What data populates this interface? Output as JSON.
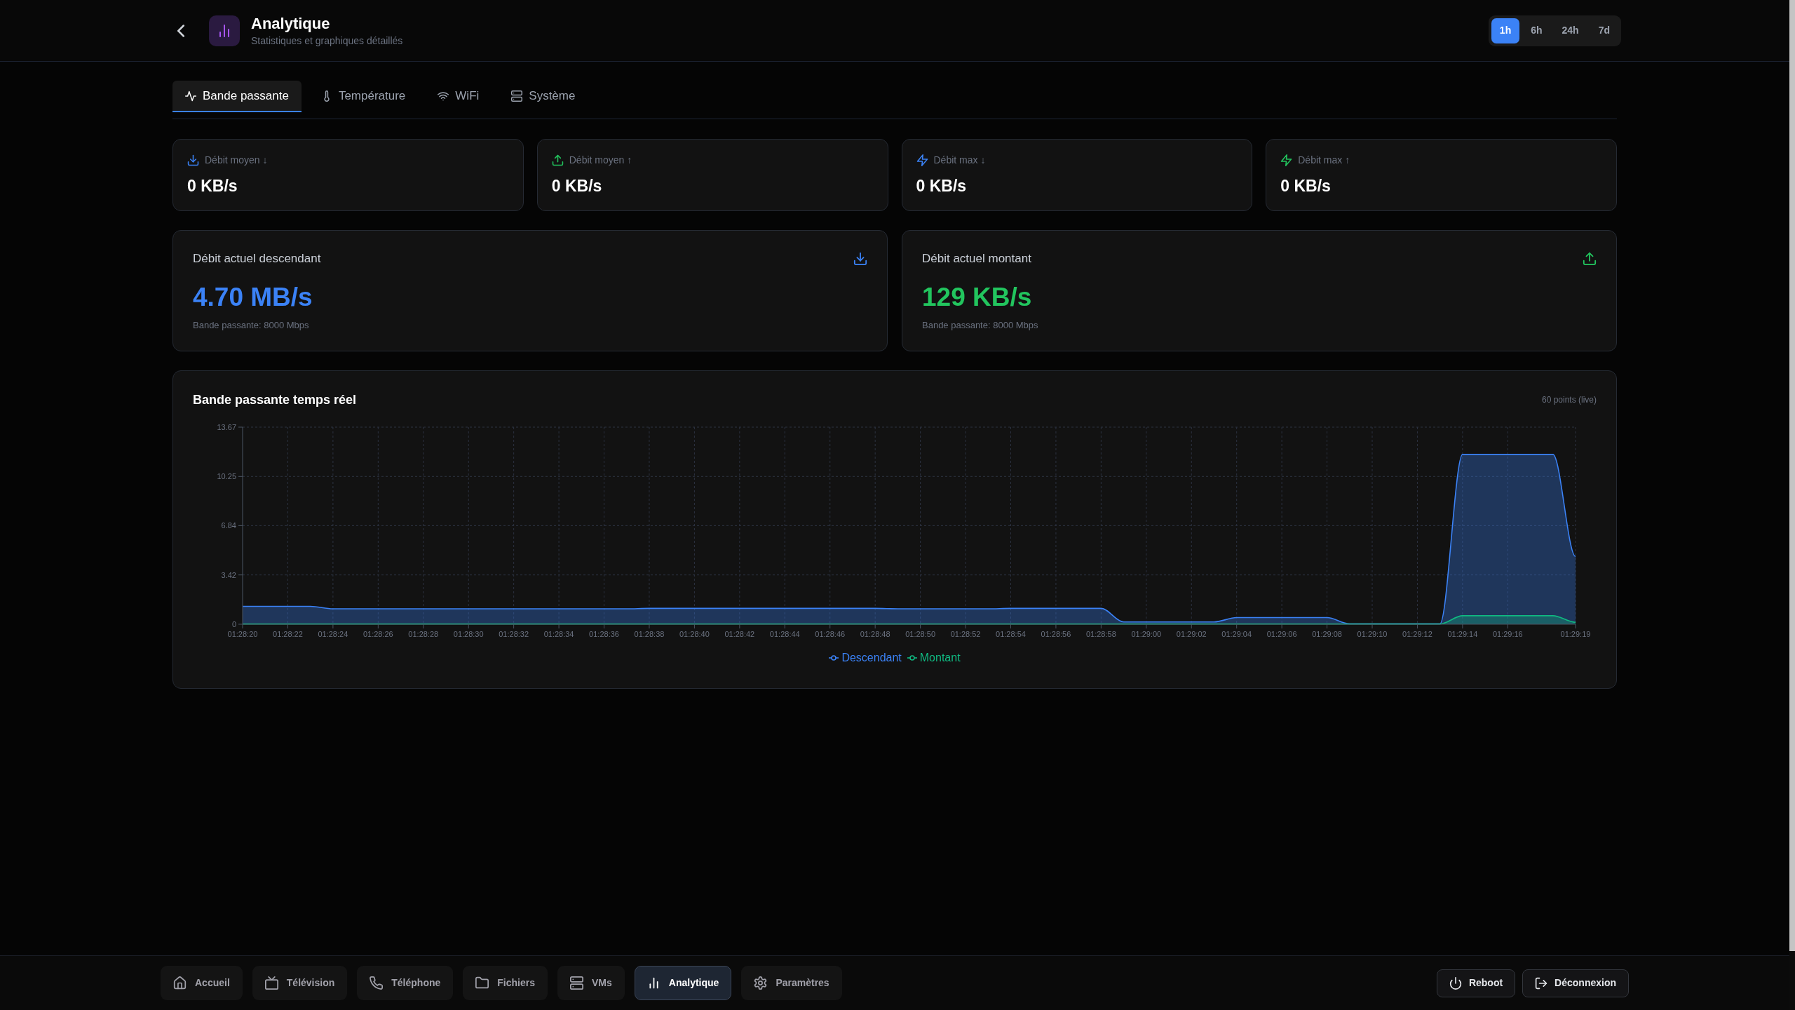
{
  "header": {
    "title": "Analytique",
    "subtitle": "Statistiques et graphiques détaillés"
  },
  "time_range": [
    {
      "label": "1h",
      "selected": true
    },
    {
      "label": "6h",
      "selected": false
    },
    {
      "label": "24h",
      "selected": false
    },
    {
      "label": "7d",
      "selected": false
    }
  ],
  "tabs": [
    {
      "label": "Bande passante",
      "selected": true
    },
    {
      "label": "Température",
      "selected": false
    },
    {
      "label": "WiFi",
      "selected": false
    },
    {
      "label": "Système",
      "selected": false
    }
  ],
  "summary_cards": [
    {
      "label": "Débit moyen ↓",
      "value": "0 KB/s",
      "color": "#3b82f6"
    },
    {
      "label": "Débit moyen ↑",
      "value": "0 KB/s",
      "color": "#22c55e"
    },
    {
      "label": "Débit max ↓",
      "value": "0 KB/s",
      "color": "#3b82f6"
    },
    {
      "label": "Débit max ↑",
      "value": "0 KB/s",
      "color": "#22c55e"
    }
  ],
  "current_cards": [
    {
      "title": "Débit actuel descendant",
      "value": "4.70 MB/s",
      "note": "Bande passante: 8000 Mbps",
      "color": "#3b82f6"
    },
    {
      "title": "Débit actuel montant",
      "value": "129 KB/s",
      "note": "Bande passante: 8000 Mbps",
      "color": "#22c55e"
    }
  ],
  "chart": {
    "title": "Bande passante temps réel",
    "note": "60 points (live)",
    "chart_data": [
      {
        "type": "area",
        "categories": [
          "01:28:20",
          null,
          "01:28:22",
          null,
          "01:28:24",
          null,
          "01:28:26",
          null,
          "01:28:28",
          null,
          "01:28:30",
          null,
          "01:28:32",
          null,
          "01:28:34",
          null,
          "01:28:36",
          null,
          "01:28:38",
          null,
          "01:28:40",
          null,
          "01:28:42",
          null,
          "01:28:44",
          null,
          "01:28:46",
          null,
          "01:28:48",
          null,
          "01:28:50",
          null,
          "01:28:52",
          null,
          "01:28:54",
          null,
          "01:28:56",
          null,
          "01:28:58",
          null,
          "01:29:00",
          null,
          "01:29:02",
          null,
          "01:29:04",
          null,
          "01:29:06",
          null,
          "01:29:08",
          null,
          "01:29:10",
          null,
          "01:29:12",
          null,
          "01:29:14",
          null,
          "01:29:16",
          null,
          null,
          "01:29:19"
        ],
        "ylim": [
          0,
          13.67
        ],
        "yticks": [
          0,
          3.42,
          6.84,
          10.25,
          13.67
        ],
        "grid": true,
        "legend": "bottom",
        "series": [
          {
            "name": "Descendant",
            "color": "#3b82f6",
            "values": [
              1.24,
              1.24,
              1.24,
              1.24,
              1.07,
              1.07,
              1.07,
              1.07,
              1.07,
              1.07,
              1.07,
              1.07,
              1.07,
              1.07,
              1.07,
              1.07,
              1.07,
              1.07,
              1.1,
              1.1,
              1.1,
              1.1,
              1.1,
              1.1,
              1.1,
              1.1,
              1.1,
              1.1,
              1.1,
              1.07,
              1.07,
              1.07,
              1.07,
              1.07,
              1.1,
              1.1,
              1.1,
              1.1,
              1.1,
              0.16,
              0.16,
              0.16,
              0.16,
              0.16,
              0.46,
              0.46,
              0.46,
              0.46,
              0.46,
              0.03,
              0.03,
              0.03,
              0.03,
              0.03,
              11.78,
              11.78,
              11.78,
              11.78,
              11.78,
              4.7
            ]
          },
          {
            "name": "Montant",
            "color": "#10b981",
            "values": [
              0.02,
              0.02,
              0.02,
              0.02,
              0.02,
              0.02,
              0.02,
              0.02,
              0.02,
              0.02,
              0.02,
              0.02,
              0.02,
              0.02,
              0.02,
              0.02,
              0.02,
              0.02,
              0.02,
              0.02,
              0.02,
              0.02,
              0.02,
              0.02,
              0.02,
              0.02,
              0.02,
              0.02,
              0.02,
              0.02,
              0.02,
              0.02,
              0.02,
              0.02,
              0.02,
              0.02,
              0.02,
              0.02,
              0.02,
              0.02,
              0.02,
              0.02,
              0.02,
              0.02,
              0.02,
              0.02,
              0.02,
              0.02,
              0.02,
              0.02,
              0.02,
              0.02,
              0.02,
              0.02,
              0.59,
              0.59,
              0.59,
              0.59,
              0.59,
              0.13
            ]
          }
        ]
      }
    ]
  },
  "bottom_nav": [
    {
      "label": "Accueil",
      "selected": false
    },
    {
      "label": "Télévision",
      "selected": false
    },
    {
      "label": "Téléphone",
      "selected": false
    },
    {
      "label": "Fichiers",
      "selected": false
    },
    {
      "label": "VMs",
      "selected": false
    },
    {
      "label": "Analytique",
      "selected": true
    },
    {
      "label": "Paramètres",
      "selected": false
    }
  ],
  "actions": [
    "Reboot",
    "Déconnexion"
  ]
}
